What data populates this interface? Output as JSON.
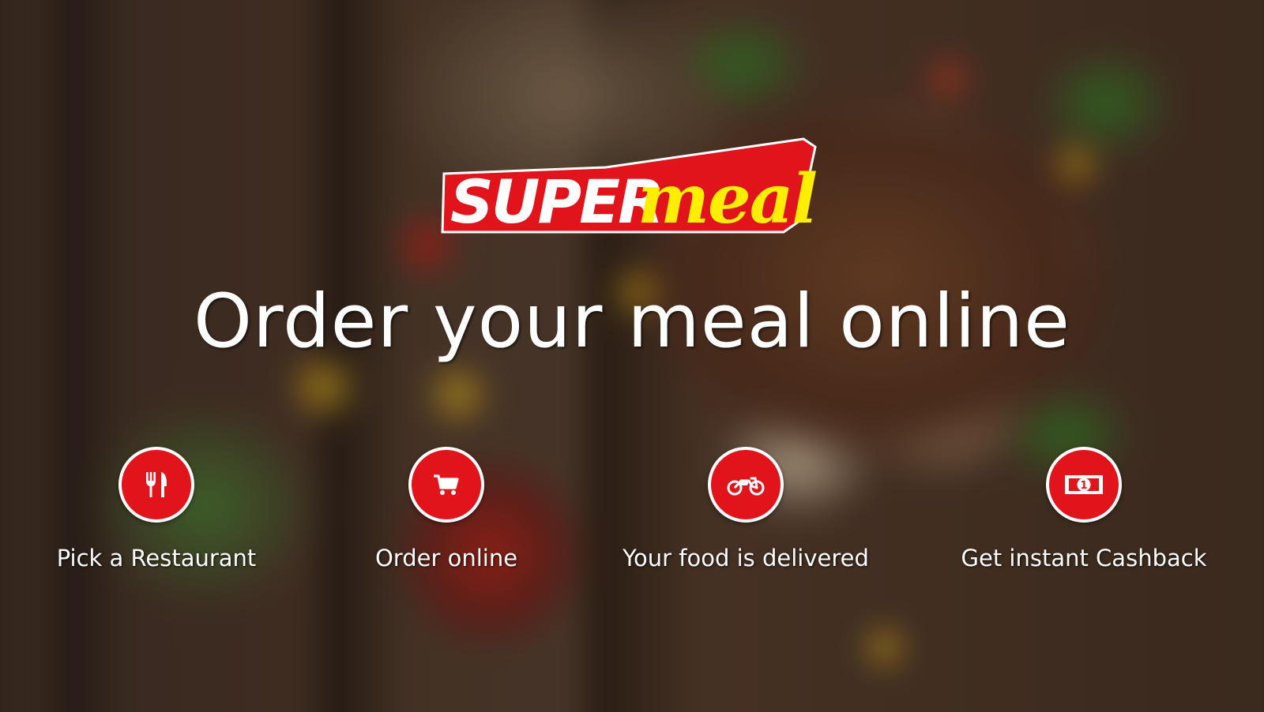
{
  "brand": {
    "logo_text_part1": "SUPER",
    "logo_text_part2": "meal",
    "colors": {
      "red": "#e2141b",
      "yellow": "#ffee00",
      "white": "#ffffff"
    }
  },
  "hero": {
    "headline": "Order your meal online"
  },
  "steps": [
    {
      "icon": "cutlery-icon",
      "label": "Pick a Restaurant"
    },
    {
      "icon": "shopping-cart-icon",
      "label": "Order online"
    },
    {
      "icon": "motorbike-icon",
      "label": "Your food is delivered"
    },
    {
      "icon": "cash-icon",
      "label": "Get instant Cashback"
    }
  ],
  "icon_text": {
    "cash_symbol": "1"
  }
}
